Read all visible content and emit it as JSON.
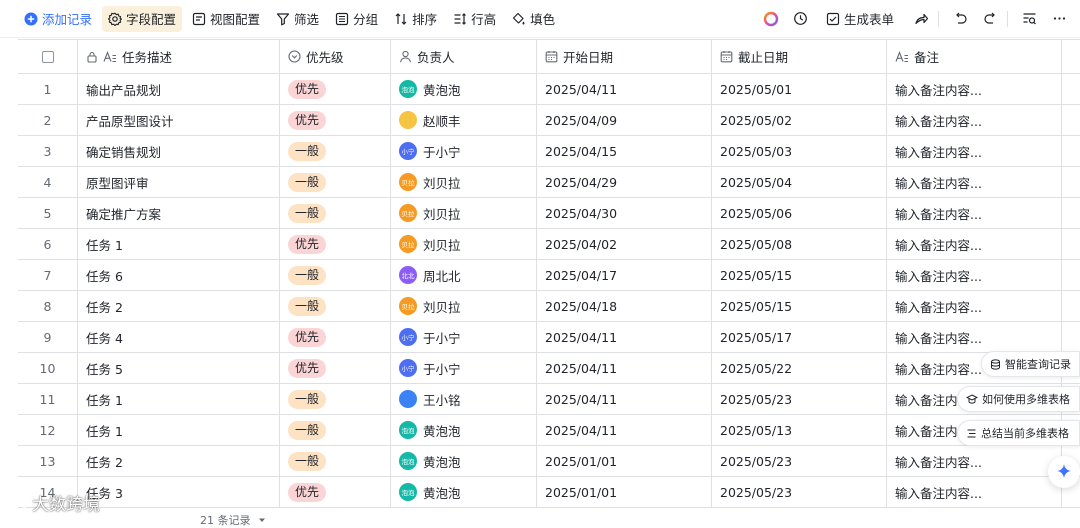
{
  "toolbar": {
    "add_record": "添加记录",
    "field_config": "字段配置",
    "view_config": "视图配置",
    "filter": "筛选",
    "group": "分组",
    "sort": "排序",
    "row_height": "行高",
    "fill_color": "填色",
    "generate_form": "生成表单"
  },
  "columns": {
    "task": "任务描述",
    "priority": "优先级",
    "owner": "负责人",
    "start": "开始日期",
    "end": "截止日期",
    "note": "备注"
  },
  "rows": [
    {
      "idx": "1",
      "task": "输出产品规划",
      "priority": "优先",
      "pri_type": "high",
      "owner": "黄泡泡",
      "avatar_text": "泡泡",
      "avatar_color": "#14b8a6",
      "start": "2025/04/11",
      "end": "2025/05/01",
      "note": "输入备注内容..."
    },
    {
      "idx": "2",
      "task": "产品原型图设计",
      "priority": "优先",
      "pri_type": "high",
      "owner": "赵顺丰",
      "avatar_text": "",
      "avatar_color": "#f5c542",
      "start": "2025/04/09",
      "end": "2025/05/02",
      "note": "输入备注内容..."
    },
    {
      "idx": "3",
      "task": "确定销售规划",
      "priority": "一般",
      "pri_type": "normal",
      "owner": "于小宁",
      "avatar_text": "小宁",
      "avatar_color": "#4e6ef2",
      "start": "2025/04/15",
      "end": "2025/05/03",
      "note": "输入备注内容..."
    },
    {
      "idx": "4",
      "task": "原型图评审",
      "priority": "一般",
      "pri_type": "normal",
      "owner": "刘贝拉",
      "avatar_text": "贝拉",
      "avatar_color": "#f59a23",
      "start": "2025/04/29",
      "end": "2025/05/04",
      "note": "输入备注内容..."
    },
    {
      "idx": "5",
      "task": "确定推广方案",
      "priority": "一般",
      "pri_type": "normal",
      "owner": "刘贝拉",
      "avatar_text": "贝拉",
      "avatar_color": "#f59a23",
      "start": "2025/04/30",
      "end": "2025/05/06",
      "note": "输入备注内容..."
    },
    {
      "idx": "6",
      "task": "任务 1",
      "priority": "优先",
      "pri_type": "high",
      "owner": "刘贝拉",
      "avatar_text": "贝拉",
      "avatar_color": "#f59a23",
      "start": "2025/04/02",
      "end": "2025/05/08",
      "note": "输入备注内容..."
    },
    {
      "idx": "7",
      "task": "任务 6",
      "priority": "一般",
      "pri_type": "normal",
      "owner": "周北北",
      "avatar_text": "北北",
      "avatar_color": "#8b5cf6",
      "start": "2025/04/17",
      "end": "2025/05/15",
      "note": "输入备注内容..."
    },
    {
      "idx": "8",
      "task": "任务 2",
      "priority": "一般",
      "pri_type": "normal",
      "owner": "刘贝拉",
      "avatar_text": "贝拉",
      "avatar_color": "#f59a23",
      "start": "2025/04/18",
      "end": "2025/05/15",
      "note": "输入备注内容..."
    },
    {
      "idx": "9",
      "task": "任务 4",
      "priority": "优先",
      "pri_type": "high",
      "owner": "于小宁",
      "avatar_text": "小宁",
      "avatar_color": "#4e6ef2",
      "start": "2025/04/11",
      "end": "2025/05/17",
      "note": "输入备注内容..."
    },
    {
      "idx": "10",
      "task": "任务 5",
      "priority": "优先",
      "pri_type": "high",
      "owner": "于小宁",
      "avatar_text": "小宁",
      "avatar_color": "#4e6ef2",
      "start": "2025/04/11",
      "end": "2025/05/22",
      "note": "输入备注内容..."
    },
    {
      "idx": "11",
      "task": "任务 1",
      "priority": "一般",
      "pri_type": "normal",
      "owner": "王小铭",
      "avatar_text": "",
      "avatar_color": "#3b82f6",
      "start": "2025/04/11",
      "end": "2025/05/23",
      "note": "输入备注内容..."
    },
    {
      "idx": "12",
      "task": "任务 1",
      "priority": "一般",
      "pri_type": "normal",
      "owner": "黄泡泡",
      "avatar_text": "泡泡",
      "avatar_color": "#14b8a6",
      "start": "2025/04/11",
      "end": "2025/05/13",
      "note": "输入备注内容..."
    },
    {
      "idx": "13",
      "task": "任务 2",
      "priority": "一般",
      "pri_type": "normal",
      "owner": "黄泡泡",
      "avatar_text": "泡泡",
      "avatar_color": "#14b8a6",
      "start": "2025/01/01",
      "end": "2025/05/23",
      "note": "输入备注内容..."
    },
    {
      "idx": "14",
      "task": "任务 3",
      "priority": "优先",
      "pri_type": "high",
      "owner": "黄泡泡",
      "avatar_text": "泡泡",
      "avatar_color": "#14b8a6",
      "start": "2025/01/01",
      "end": "2025/05/23",
      "note": "输入备注内容..."
    }
  ],
  "floating": {
    "smart_query": "智能查询记录",
    "how_to_use": "如何使用多维表格",
    "summarize": "总结当前多维表格"
  },
  "footer": {
    "record_count": "21 条记录"
  },
  "brand": {
    "logo_text": "大数跨境"
  },
  "colors": {
    "accent": "#3370ff",
    "high_tag": "#fbd5d5",
    "normal_tag": "#fde2c4"
  }
}
